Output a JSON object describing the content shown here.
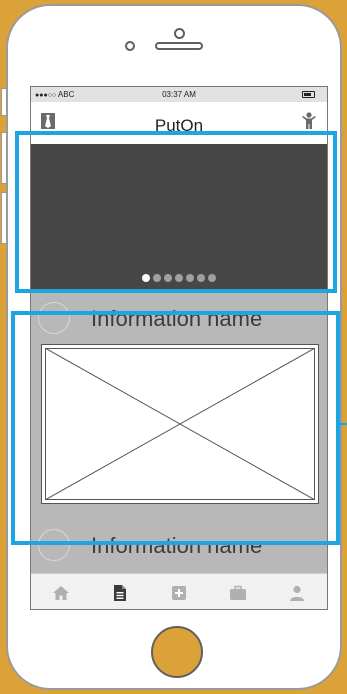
{
  "status_bar": {
    "signal_dots": "●●●○○",
    "carrier": "ABC",
    "time": "03:37 AM",
    "battery_icon": "battery-icon"
  },
  "nav_bar": {
    "title": "PutOn",
    "left_icon": "tie-icon",
    "right_icon": "person-icon"
  },
  "banner": {
    "page_count": 7,
    "active_page": 1
  },
  "feed": {
    "items": [
      {
        "name": "Information name"
      },
      {
        "name": "Information name"
      }
    ]
  },
  "tab_bar": {
    "tabs": [
      {
        "icon": "home-icon",
        "active": false
      },
      {
        "icon": "document-icon",
        "active": true
      },
      {
        "icon": "plus-square-icon",
        "active": false
      },
      {
        "icon": "briefcase-icon",
        "active": false
      },
      {
        "icon": "user-icon",
        "active": false
      }
    ]
  },
  "colors": {
    "background": "#dba239",
    "highlight": "#1ea6e3",
    "banner": "#474747",
    "content": "#b8b8b8"
  }
}
